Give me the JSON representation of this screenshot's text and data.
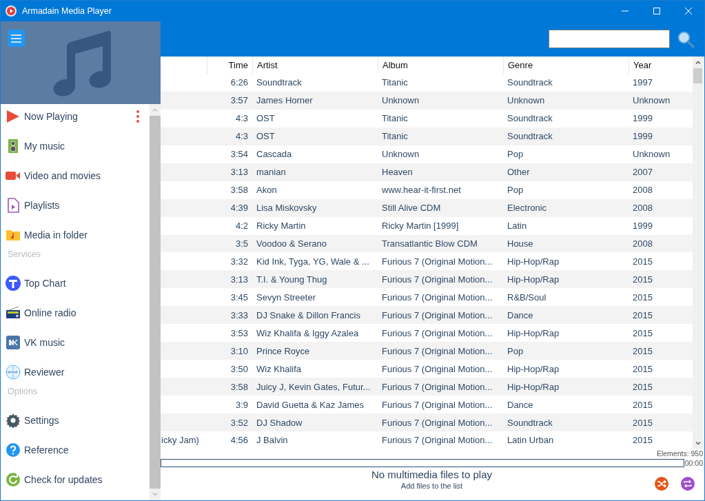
{
  "window": {
    "title": "Armadain Media Player"
  },
  "sidebar": {
    "items": [
      {
        "label": "Now Playing",
        "kind": "item",
        "more": true
      },
      {
        "label": "My music",
        "kind": "item"
      },
      {
        "label": "Video and movies",
        "kind": "item"
      },
      {
        "label": "Playlists",
        "kind": "item"
      },
      {
        "label": "Media in folder",
        "kind": "item"
      },
      {
        "label": "Services",
        "kind": "heading"
      },
      {
        "label": "Top Chart",
        "kind": "item"
      },
      {
        "label": "Online radio",
        "kind": "item"
      },
      {
        "label": "VK music",
        "kind": "item"
      },
      {
        "label": "Reviewer",
        "kind": "item"
      },
      {
        "label": "Options",
        "kind": "heading"
      },
      {
        "label": "Settings",
        "kind": "item"
      },
      {
        "label": "Reference",
        "kind": "item"
      },
      {
        "label": "Check for updates",
        "kind": "item"
      }
    ]
  },
  "table": {
    "columns": [
      "Time",
      "Artist",
      "Album",
      "Genre",
      "Year"
    ],
    "rows": [
      {
        "time": "6:26",
        "artist": "Soundtrack",
        "album": "Titanic",
        "genre": "Soundtrack",
        "year": "1997"
      },
      {
        "time": "3:57",
        "artist": "James Horner",
        "album": "Unknown",
        "genre": "Unknown",
        "year": "Unknown"
      },
      {
        "time": "4:3",
        "artist": "OST",
        "album": "Titanic",
        "genre": "Soundtrack",
        "year": "1999"
      },
      {
        "time": "4:3",
        "artist": "OST",
        "album": "Titanic",
        "genre": "Soundtrack",
        "year": "1999"
      },
      {
        "time": "3:54",
        "artist": "Cascada",
        "album": "Unknown",
        "genre": "Pop",
        "year": "Unknown"
      },
      {
        "time": "3:13",
        "artist": "manian",
        "album": "Heaven",
        "genre": "Other",
        "year": "2007"
      },
      {
        "time": "3:58",
        "artist": "Akon",
        "album": "www.hear-it-first.net",
        "genre": "Pop",
        "year": "2008"
      },
      {
        "time": "4:39",
        "artist": "Lisa Miskovsky",
        "album": "Still Alive CDM",
        "genre": "Electronic",
        "year": "2008"
      },
      {
        "time": "4:2",
        "artist": "Ricky Martin",
        "album": "Ricky Martin [1999]",
        "genre": "Latin",
        "year": "1999"
      },
      {
        "time": "3:5",
        "artist": "Voodoo & Serano",
        "album": "Transatlantic Blow CDM",
        "genre": "House",
        "year": "2008"
      },
      {
        "time": "3:32",
        "artist": "Kid Ink, Tyga, YG, Wale & ...",
        "album": "Furious 7 (Original Motion...",
        "genre": "Hip-Hop/Rap",
        "year": "2015"
      },
      {
        "time": "3:13",
        "artist": "T.I. & Young Thug",
        "album": "Furious 7 (Original Motion...",
        "genre": "Hip-Hop/Rap",
        "year": "2015"
      },
      {
        "time": "3:45",
        "artist": "Sevyn Streeter",
        "album": "Furious 7 (Original Motion...",
        "genre": "R&B/Soul",
        "year": "2015"
      },
      {
        "time": "3:33",
        "artist": "DJ Snake & Dillon Francis",
        "album": "Furious 7 (Original Motion...",
        "genre": "Dance",
        "year": "2015"
      },
      {
        "time": "3:53",
        "artist": "Wiz Khalifa & Iggy Azalea",
        "album": "Furious 7 (Original Motion...",
        "genre": "Hip-Hop/Rap",
        "year": "2015"
      },
      {
        "time": "3:10",
        "artist": "Prince Royce",
        "album": "Furious 7 (Original Motion...",
        "genre": "Pop",
        "year": "2015"
      },
      {
        "time": "3:50",
        "artist": "Wiz Khalifa",
        "album": "Furious 7 (Original Motion...",
        "genre": "Hip-Hop/Rap",
        "year": "2015"
      },
      {
        "time": "3:58",
        "artist": "Juicy J, Kevin Gates, Futur...",
        "album": "Furious 7 (Original Motion...",
        "genre": "Hip-Hop/Rap",
        "year": "2015"
      },
      {
        "time": "3:9",
        "artist": "David Guetta & Kaz James",
        "album": "Furious 7 (Original Motion...",
        "genre": "Dance",
        "year": "2015"
      },
      {
        "time": "3:52",
        "artist": "DJ Shadow",
        "album": "Furious 7 (Original Motion...",
        "genre": "Soundtrack",
        "year": "2015"
      },
      {
        "column_1": "icky Jam)",
        "time": "4:56",
        "artist": "J Balvin",
        "album": "Furious 7 (Original Motion...",
        "genre": "Latin Urban",
        "year": "2015"
      }
    ]
  },
  "footer": {
    "progress": {
      "level": 0
    },
    "elements": "Elements: 950",
    "time": "00:00",
    "status": "No multimedia files to play",
    "hint": "Add files to the list"
  }
}
